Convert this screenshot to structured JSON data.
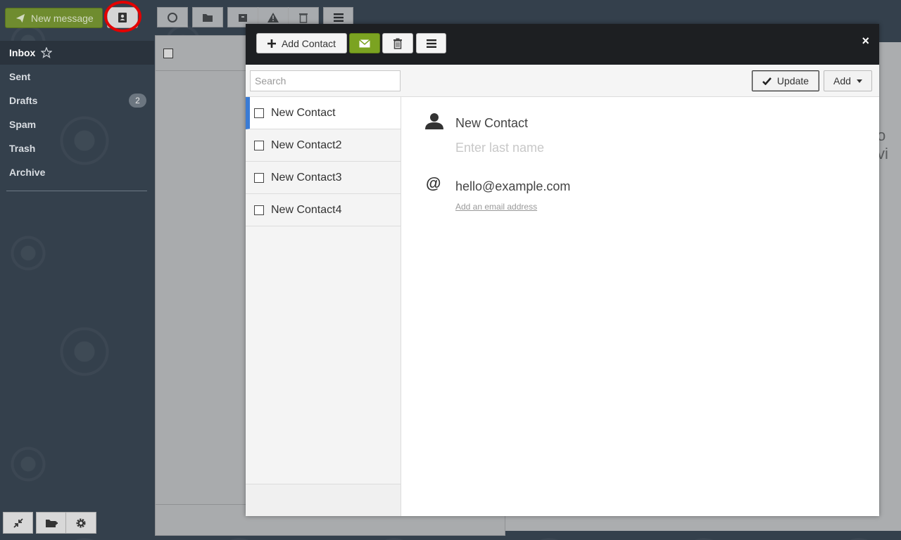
{
  "toolbar": {
    "new_message_label": "New message"
  },
  "sidebar": {
    "folders": [
      {
        "label": "Inbox",
        "active": true
      },
      {
        "label": "Sent"
      },
      {
        "label": "Drafts",
        "count": "2"
      },
      {
        "label": "Spam"
      },
      {
        "label": "Trash"
      },
      {
        "label": "Archive"
      }
    ]
  },
  "background": {
    "preview_peek_text": "o vi"
  },
  "contacts_modal": {
    "add_contact_label": "Add Contact",
    "close_label": "×",
    "search_placeholder": "Search",
    "update_label": "Update",
    "add_label": "Add",
    "contacts": [
      {
        "name": "New Contact",
        "selected": true
      },
      {
        "name": "New Contact2"
      },
      {
        "name": "New Contact3"
      },
      {
        "name": "New Contact4"
      }
    ],
    "detail": {
      "first_name": "New Contact",
      "last_name_placeholder": "Enter last name",
      "email": "hello@example.com",
      "add_email_link": "Add an email address"
    }
  },
  "colors": {
    "accent_green": "#7ba321",
    "selected_blue": "#3a7bd5",
    "highlight_ring": "#e30000"
  }
}
